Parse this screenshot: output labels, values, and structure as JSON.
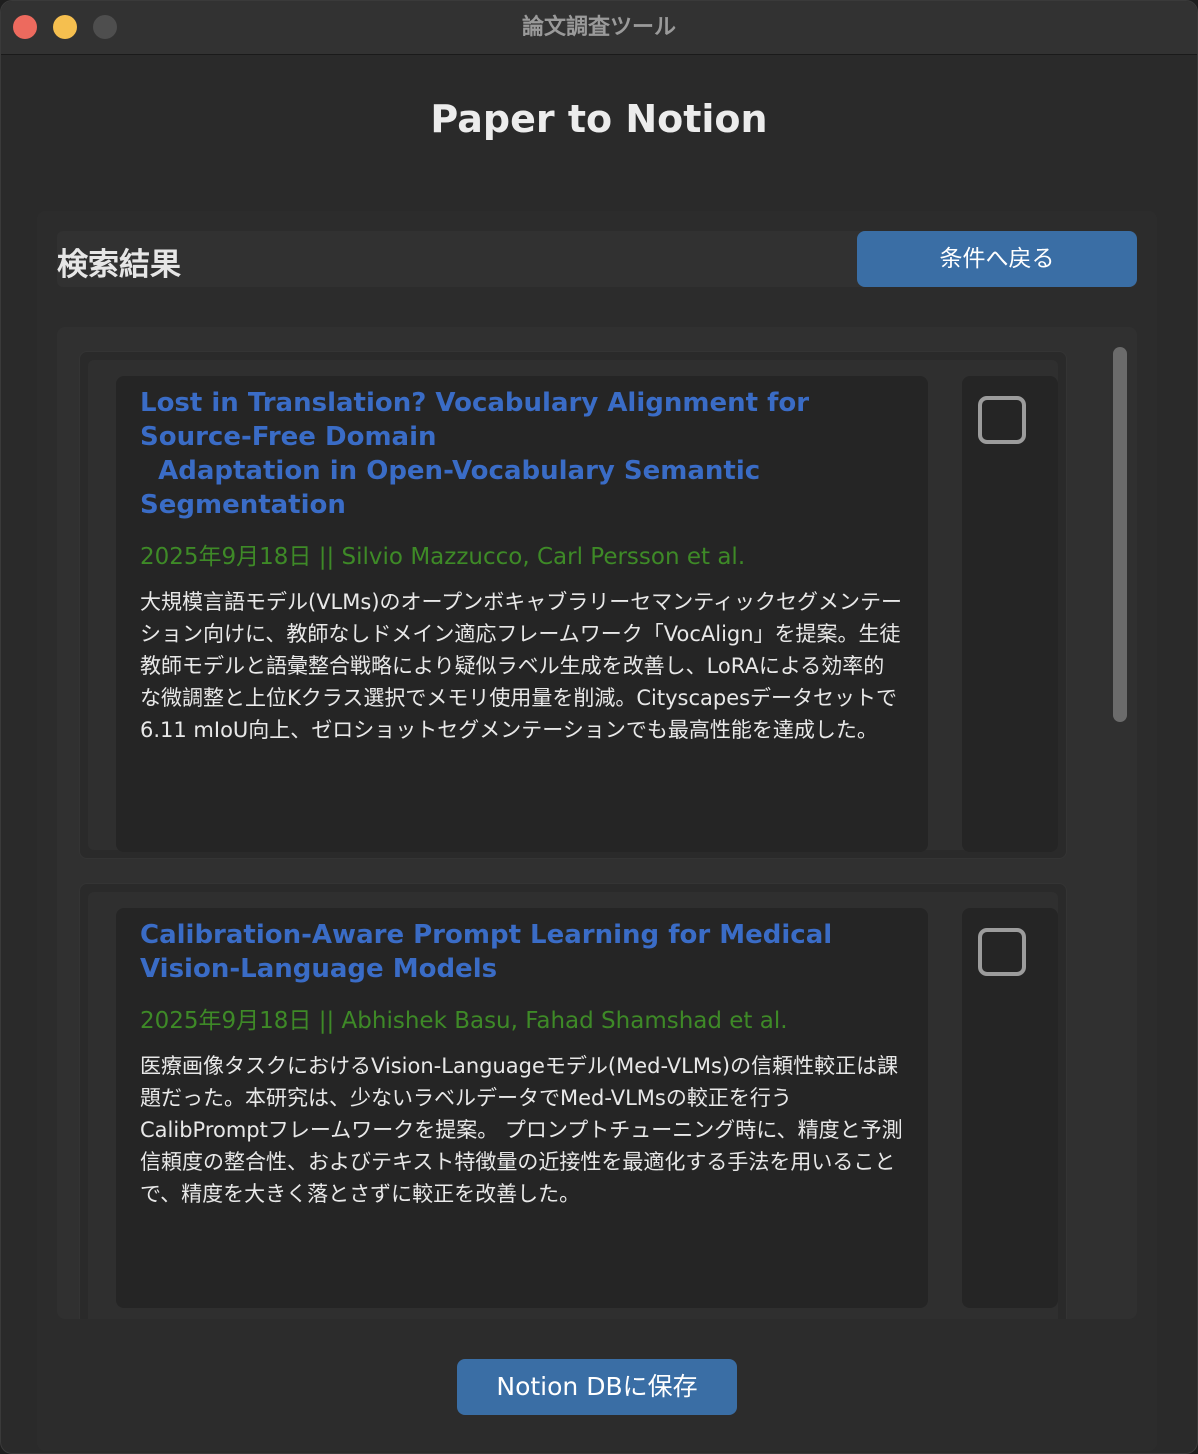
{
  "window": {
    "title": "論文調査ツール"
  },
  "app": {
    "title": "Paper to Notion"
  },
  "results": {
    "heading": "検索結果",
    "back_label": "条件へ戻る",
    "save_label": "Notion DBに保存",
    "papers": [
      {
        "title": "Lost in Translation? Vocabulary Alignment for\nSource-Free Domain\n  Adaptation in Open-Vocabulary Semantic\nSegmentation",
        "meta": "2025年9月18日 || Silvio Mazzucco, Carl Persson et al.",
        "summary": "大規模言語モデル(VLMs)のオープンボキャブラリーセマンティックセグメンテーション向けに、教師なしドメイン適応フレームワーク「VocAlign」を提案。生徒教師モデルと語彙整合戦略により疑似ラベル生成を改善し、LoRAによる効率的な微調整と上位Kクラス選択でメモリ使用量を削減。Cityscapesデータセットで6.11 mIoU向上、ゼロショットセグメンテーションでも最高性能を達成した。",
        "checked": false
      },
      {
        "title": "Calibration-Aware Prompt Learning for Medical\nVision-Language Models",
        "meta": "2025年9月18日 || Abhishek Basu, Fahad Shamshad et al.",
        "summary": "医療画像タスクにおけるVision-Languageモデル(Med-VLMs)の信頼性較正は課題だった。本研究は、少ないラベルデータでMed-VLMsの較正を行うCalibPromptフレームワークを提案。 プロンプトチューニング時に、精度と予測信頼度の整合性、およびテキスト特徴量の近接性を最適化する手法を用いることで、精度を大きく落とさずに較正を改善した。",
        "checked": false
      }
    ]
  }
}
